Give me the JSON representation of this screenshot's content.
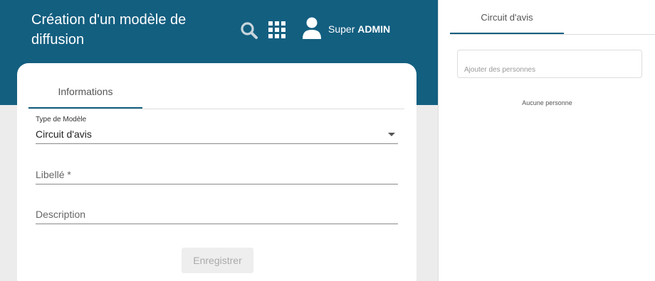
{
  "header": {
    "title": "Création d'un modèle de diffusion",
    "icons": [
      "search-icon",
      "apps-grid-icon",
      "user-icon"
    ],
    "user_first": "Super",
    "user_last": "ADMIN",
    "colors": {
      "header_bg": "#135f80",
      "accent": "#135f80"
    }
  },
  "form": {
    "tab_label": "Informations",
    "type_label": "Type de Modèle",
    "type_value": "Circuit d'avis",
    "libelle_placeholder": "Libellé *",
    "description_placeholder": "Description",
    "save_label": "Enregistrer"
  },
  "side_panel": {
    "tab_label": "Circuit d'avis",
    "search_placeholder": "Ajouter des personnes",
    "empty_text": "Aucune personne"
  }
}
